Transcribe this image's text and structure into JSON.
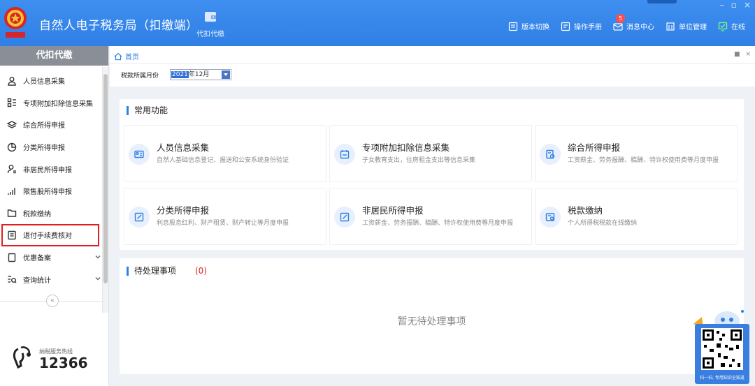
{
  "app": {
    "title": "自然人电子税务局（扣缴端）"
  },
  "top_module": {
    "label": "代扣代缴",
    "icon": "wallet-icon"
  },
  "top_actions": [
    {
      "label": "版本切换",
      "icon": "switch-icon"
    },
    {
      "label": "操作手册",
      "icon": "manual-icon"
    },
    {
      "label": "消息中心",
      "icon": "mail-icon",
      "badge": "5"
    },
    {
      "label": "单位管理",
      "icon": "building-icon"
    },
    {
      "label": "在线",
      "icon": "online-icon"
    }
  ],
  "window_controls": [
    "–",
    "▫",
    "×"
  ],
  "sidebar": {
    "title": "代扣代缴",
    "items": [
      {
        "label": "人员信息采集",
        "icon": "person-icon"
      },
      {
        "label": "专项附加扣除信息采集",
        "icon": "list-grid-icon"
      },
      {
        "label": "综合所得申报",
        "icon": "layers-icon"
      },
      {
        "label": "分类所得申报",
        "icon": "pie-icon"
      },
      {
        "label": "非居民所得申报",
        "icon": "person-outline-icon"
      },
      {
        "label": "限售股所得申报",
        "icon": "bar-signal-icon"
      },
      {
        "label": "税款缴纳",
        "icon": "folder-icon"
      },
      {
        "label": "退付手续费核对",
        "icon": "receipt-icon",
        "highlighted": true
      },
      {
        "label": "优惠备案",
        "icon": "document-icon",
        "expandable": true
      },
      {
        "label": "查询统计",
        "icon": "search-list-icon",
        "expandable": true
      }
    ],
    "collapse_label": "«",
    "hotline": {
      "label": "纳税服务热线",
      "number": "12366"
    }
  },
  "tabs": {
    "home_label": "首页",
    "controls": [
      "■",
      "×"
    ]
  },
  "period": {
    "label": "税款所属月份",
    "year": "2021",
    "month": "年12月"
  },
  "common": {
    "title": "常用功能",
    "cards": [
      {
        "title": "人员信息采集",
        "desc": "自然人基础信息登记、报送和公安系统身份验证",
        "icon": "id-card-icon"
      },
      {
        "title": "专项附加扣除信息采集",
        "desc": "子女教育支出，住房租金支出等信息采集",
        "icon": "calendar-icon"
      },
      {
        "title": "综合所得申报",
        "desc": "工资薪金、劳务报酬、稿酬、特许权使用费等月度申报",
        "icon": "doc-add-icon"
      },
      {
        "title": "分类所得申报",
        "desc": "利息股息红利、财产租赁、财产转让等月度申报",
        "icon": "edit-icon"
      },
      {
        "title": "非居民所得申报",
        "desc": "工资薪金、劳务报酬、稿酬、特许权使用费等月度申报",
        "icon": "edit-icon"
      },
      {
        "title": "税款缴纳",
        "desc": "个人所得税税款在线缴纳",
        "icon": "pay-icon"
      }
    ]
  },
  "todo": {
    "title": "待处理事项",
    "count": "(0)",
    "empty": "暂无待处理事项"
  },
  "qr": {
    "caption": "扫一扫, 专用知识全知道"
  }
}
